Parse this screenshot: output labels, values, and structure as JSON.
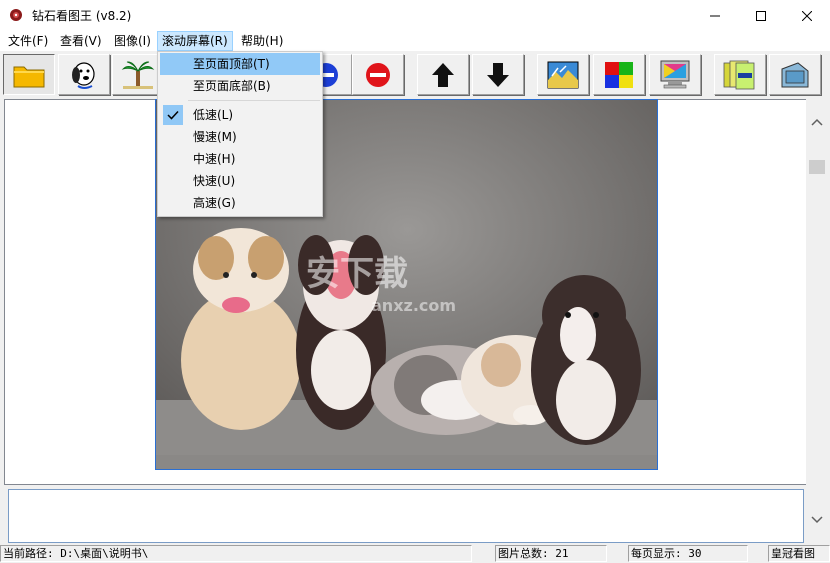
{
  "window": {
    "title": "钻石看图王 (v8.2)"
  },
  "menu": {
    "file": "文件(F)",
    "view": "查看(V)",
    "image": "图像(I)",
    "scroll": "滚动屏幕(R)",
    "help": "帮助(H)"
  },
  "toolbar": {
    "buttons": [
      "open-folder-icon",
      "dog-icon",
      "palm-tree-icon",
      "blue-circle-icon",
      "stop-icon",
      "arrow-up-icon",
      "arrow-down-icon",
      "landscape-icon",
      "color-grid-icon",
      "monitor-icon",
      "labels-icon",
      "slide-icon"
    ]
  },
  "scroll_menu": {
    "items": [
      {
        "label": "至页面顶部(T)"
      },
      {
        "label": "至页面底部(B)"
      },
      {
        "label": "低速(L)"
      },
      {
        "label": "慢速(M)"
      },
      {
        "label": "中速(H)"
      },
      {
        "label": "快速(U)"
      },
      {
        "label": "高速(G)"
      }
    ],
    "checked_item": "低速(L)"
  },
  "watermark": {
    "text": "安下载",
    "sub": "anxz.com"
  },
  "status": {
    "path": "当前路径: D:\\桌面\\说明书\\",
    "total": "图片总数: 21",
    "per_page": "每页显示: 30",
    "app": "皇冠看图"
  },
  "colors": {
    "accent": "#91c9f7",
    "menu_active": "#cce8ff",
    "image_border": "#2a6fd3"
  }
}
